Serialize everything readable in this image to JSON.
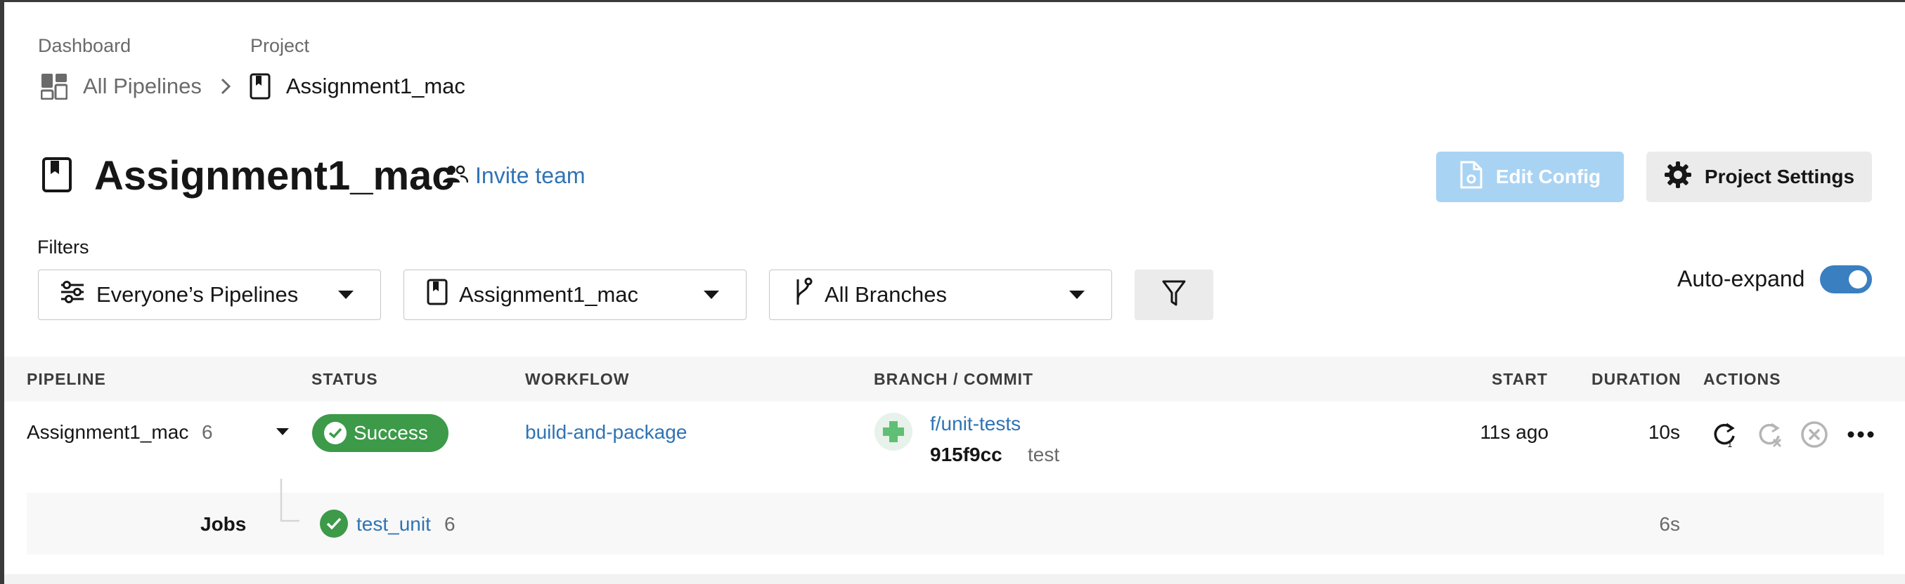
{
  "breadcrumb": {
    "dashboard_label": "Dashboard",
    "project_label": "Project",
    "all_pipelines": "All Pipelines",
    "project_name": "Assignment1_mac"
  },
  "header": {
    "title": "Assignment1_mac",
    "invite_team": "Invite team",
    "edit_config": "Edit Config",
    "project_settings": "Project Settings"
  },
  "filters": {
    "label": "Filters",
    "pipelines_select": "Everyone’s Pipelines",
    "project_select": "Assignment1_mac",
    "branch_select": "All Branches",
    "auto_expand_label": "Auto-expand",
    "auto_expand_on": true
  },
  "table": {
    "columns": [
      "PIPELINE",
      "STATUS",
      "WORKFLOW",
      "BRANCH / COMMIT",
      "START",
      "DURATION",
      "ACTIONS"
    ],
    "rows": [
      {
        "pipeline": "Assignment1_mac",
        "number": "6",
        "status": "Success",
        "workflow": "build-and-package",
        "branch": "f/unit-tests",
        "commit_hash": "915f9cc",
        "commit_msg": "test",
        "start": "11s ago",
        "duration": "10s",
        "jobs_label": "Jobs",
        "job_name": "test_unit",
        "job_number": "6",
        "job_duration": "6s"
      }
    ]
  },
  "colors": {
    "accent": "#2f73b4",
    "success": "#3c9a48",
    "edit_config_bg": "#a9d3f3",
    "toggle_on": "#3a7fc0"
  },
  "icons": {
    "dashboard": "dashboard-grid-icon",
    "chevron": "chevron-right-icon",
    "project": "bookmark-icon",
    "team": "people-icon",
    "config": "document-gear-icon",
    "settings": "gear-icon",
    "pipelines": "sliders-icon",
    "branch": "git-branch-icon",
    "filter": "funnel-icon",
    "rerun": "rerun-icon",
    "rerun_failed": "rerun-failed-icon",
    "cancel": "cancel-circle-icon",
    "more": "more-horizontal-icon"
  }
}
